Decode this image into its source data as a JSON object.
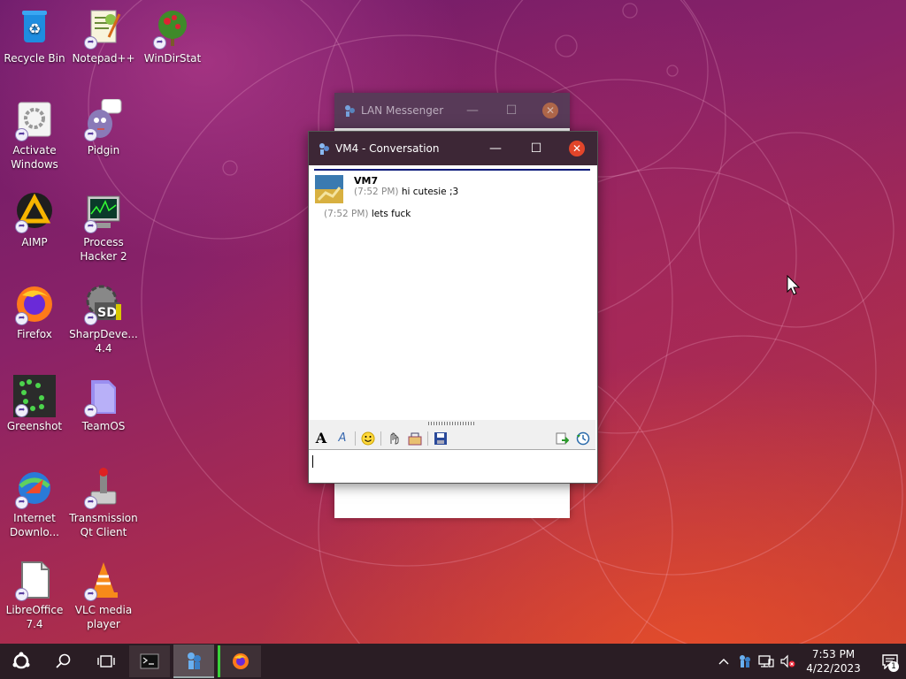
{
  "desktop": {
    "icons": [
      {
        "label": "Recycle Bin"
      },
      {
        "label": "Notepad++"
      },
      {
        "label": "WinDirStat"
      },
      {
        "label": "Activate Windows"
      },
      {
        "label": "Pidgin"
      },
      {
        "label": "AIMP"
      },
      {
        "label": "Process Hacker 2"
      },
      {
        "label": "Firefox"
      },
      {
        "label": "SharpDeve... 4.4"
      },
      {
        "label": "Greenshot"
      },
      {
        "label": "TeamOS"
      },
      {
        "label": "Internet Downlo..."
      },
      {
        "label": "Transmission Qt Client"
      },
      {
        "label": "LibreOffice 7.4"
      },
      {
        "label": "VLC media player"
      }
    ]
  },
  "back_window": {
    "title": "LAN Messenger"
  },
  "conversation_window": {
    "title": "VM4 - Conversation",
    "messages": [
      {
        "sender": "VM7",
        "time": "(7:52 PM)",
        "text": "hi cutesie ;3"
      },
      {
        "time": "(7:52 PM)",
        "text": "lets fuck"
      }
    ],
    "toolbar": [
      "font-icon",
      "font-color-icon",
      "emoticon-icon",
      "nudge-icon",
      "broadcast-icon",
      "save-icon",
      "send-file-icon",
      "history-icon"
    ],
    "input_value": ""
  },
  "taskbar": {
    "clock_time": "7:53 PM",
    "clock_date": "4/22/2023",
    "notification_count": "1"
  },
  "colors": {
    "titlebar": "#3d2736",
    "close_button": "#e2452a",
    "taskbar": "#2a1d24",
    "chat_divider": "#0a1a7a"
  }
}
